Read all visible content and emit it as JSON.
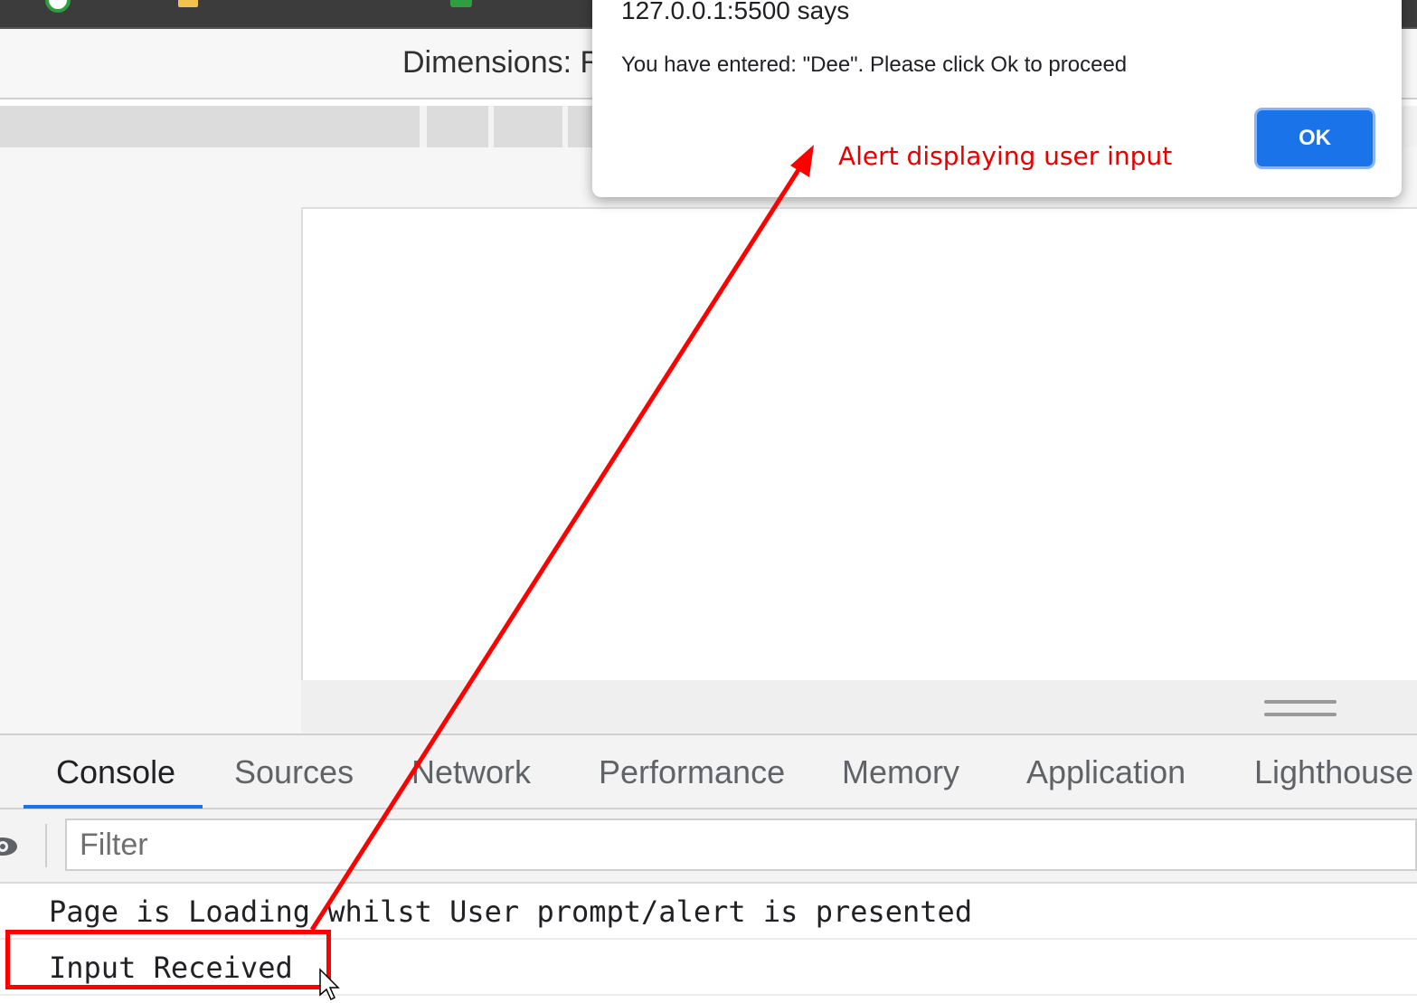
{
  "alert": {
    "title": "127.0.0.1:5500 says",
    "message": "You have entered: \"Dee\". Please click Ok to proceed",
    "ok_label": "OK"
  },
  "device_toolbar": {
    "dimensions_label": "Dimensions: R"
  },
  "devtools": {
    "tabs": [
      {
        "label": "Console",
        "active": true
      },
      {
        "label": "Sources",
        "active": false
      },
      {
        "label": "Network",
        "active": false
      },
      {
        "label": "Performance",
        "active": false
      },
      {
        "label": "Memory",
        "active": false
      },
      {
        "label": "Application",
        "active": false
      },
      {
        "label": "Lighthouse",
        "active": false
      }
    ],
    "filter_placeholder": "Filter",
    "console_lines": [
      "Page is Loading whilst User prompt/alert is presented",
      "Input Received"
    ]
  },
  "annotation": {
    "label": "Alert displaying user input",
    "color": "#e60000"
  },
  "colors": {
    "accent": "#1a73e8",
    "annotation_red": "#ff0000"
  }
}
